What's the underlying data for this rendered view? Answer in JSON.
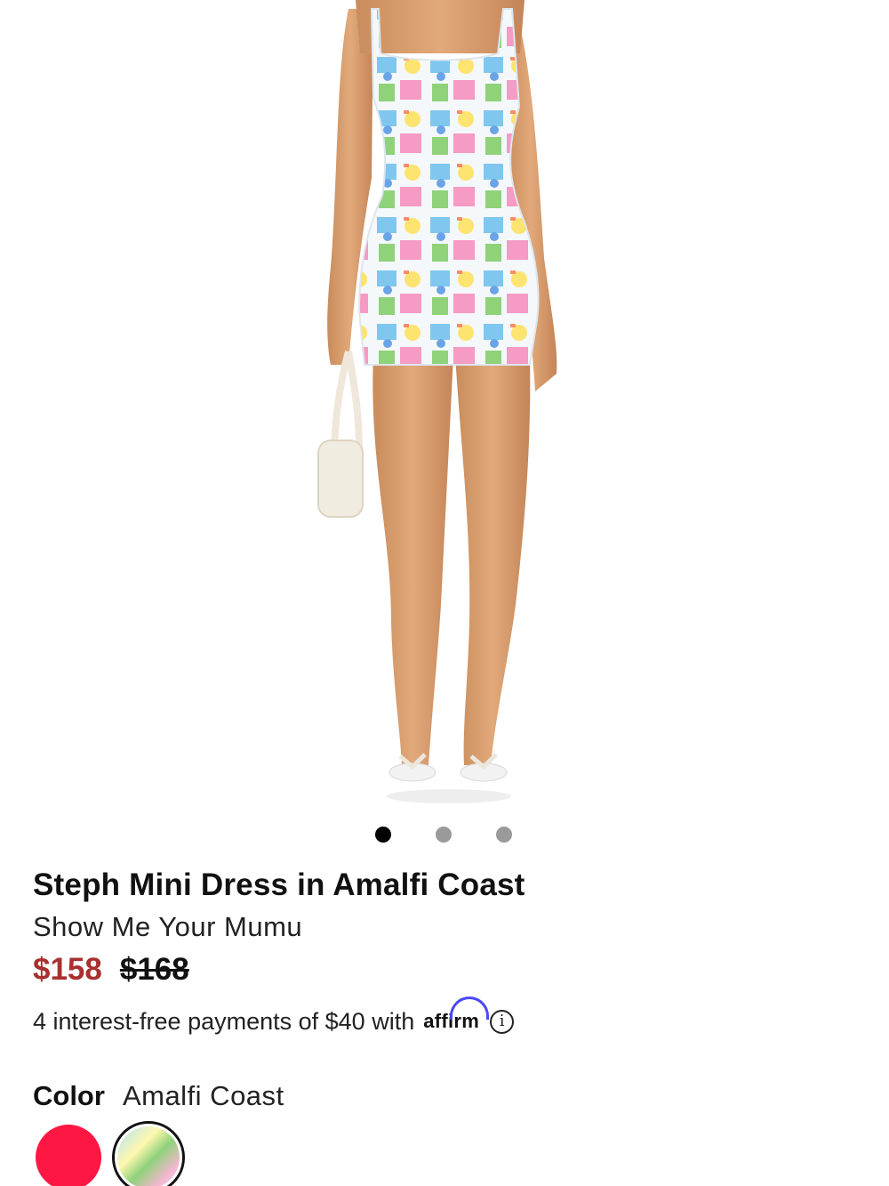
{
  "product": {
    "title": "Steph Mini Dress in Amalfi Coast",
    "brand": "Show Me Your Mumu",
    "price_sale": "$158",
    "price_original": "$168"
  },
  "carousel": {
    "total_slides": 3,
    "active_index": 0
  },
  "payment": {
    "text": "4 interest-free payments of $40 with",
    "provider_logo": "affirm",
    "info_icon": "info-icon"
  },
  "color": {
    "label": "Color",
    "selected": "Amalfi Coast",
    "swatches": [
      {
        "name": "red",
        "color": "#ff1744",
        "selected": false
      },
      {
        "name": "Amalfi Coast",
        "pattern": "multicolor-print",
        "selected": true
      }
    ]
  },
  "colors": {
    "sale_price": "#a8302f",
    "affirm_arc": "#4a4af4"
  }
}
